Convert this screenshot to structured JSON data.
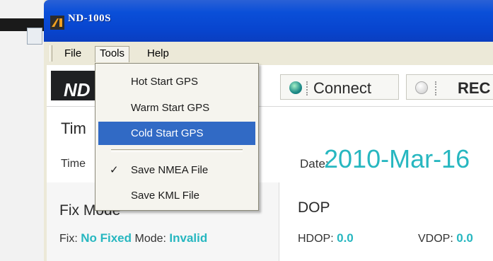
{
  "window": {
    "title": "ND-100S"
  },
  "menubar": {
    "items": [
      {
        "label": "File"
      },
      {
        "label": "Tools"
      },
      {
        "label": "Help"
      }
    ]
  },
  "tools_menu": {
    "items": [
      {
        "label": "Hot Start GPS"
      },
      {
        "label": "Warm Start GPS"
      },
      {
        "label": "Cold Start GPS",
        "highlighted": true
      },
      {
        "label": "Save NMEA File",
        "checked": true
      },
      {
        "label": "Save KML File"
      }
    ]
  },
  "toolbar": {
    "logo_text": "ND",
    "connect_label": "Connect",
    "rec_label": "REC"
  },
  "time_panel": {
    "title": "Tim",
    "time_label": "Time",
    "date_label": "Date:",
    "date_value": "2010-Mar-16"
  },
  "fix_panel": {
    "title": "Fix Mode",
    "fix_label": "Fix:",
    "fix_value": "No Fixed",
    "mode_label": "Mode:",
    "mode_value": "Invalid"
  },
  "dop_panel": {
    "title": "DOP",
    "hdop_label": "HDOP:",
    "hdop_value": "0.0",
    "vdop_label": "VDOP:",
    "vdop_value": "0.0"
  },
  "colors": {
    "accent": "#27b7c0",
    "highlight": "#316ac5",
    "titlebar": "#0845cf"
  }
}
